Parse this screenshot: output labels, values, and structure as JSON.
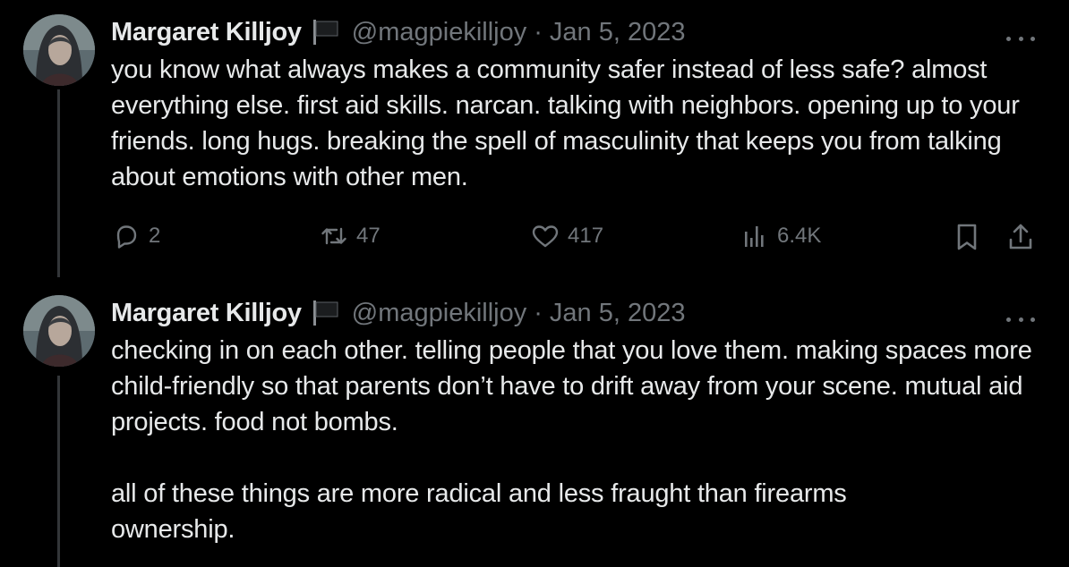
{
  "tweets": [
    {
      "author_name": "Margaret Killjoy",
      "handle": "@magpiekilljoy",
      "separator": "·",
      "date": "Jan 5, 2023",
      "paragraphs": [
        "you know what always makes a community safer instead of less safe? almost everything else. first aid skills. narcan. talking with neighbors. opening up to your friends. long hugs. breaking the spell of masculinity that keeps you from talking about emotions with other men."
      ],
      "replies": "2",
      "reposts": "47",
      "likes": "417",
      "views": "6.4K"
    },
    {
      "author_name": "Margaret Killjoy",
      "handle": "@magpiekilljoy",
      "separator": "·",
      "date": "Jan 5, 2023",
      "paragraphs": [
        "checking in on each other. telling people that you love them. making spaces more child-friendly so that parents don’t have to drift away from your scene. mutual aid projects. food not bombs.",
        "all of these things are more radical and less fraught than firearms ownership."
      ]
    }
  ],
  "icons": {
    "flag": "black-flag-icon",
    "more": "more-horizontal-icon",
    "reply": "reply-icon",
    "repost": "repost-icon",
    "like": "heart-icon",
    "views": "views-bar-chart-icon",
    "bookmark": "bookmark-icon",
    "share": "share-icon"
  },
  "colors": {
    "background": "#000000",
    "text": "#e7e9ea",
    "secondary": "#71767b",
    "thread_line": "#333639"
  }
}
